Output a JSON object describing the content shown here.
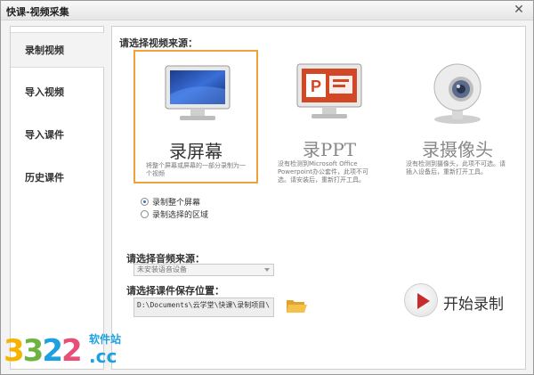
{
  "window": {
    "title": "快课-视频采集",
    "close_glyph": "✕"
  },
  "sidebar": {
    "items": [
      {
        "label": "录制视频",
        "active": true
      },
      {
        "label": "导入视频",
        "active": false
      },
      {
        "label": "导入课件",
        "active": false
      },
      {
        "label": "历史课件",
        "active": false
      }
    ]
  },
  "main": {
    "source_label": "请选择视频来源：",
    "cards": [
      {
        "title": "录屏幕",
        "desc": "将整个屏幕或屏幕的一部分录制为一个视频",
        "icon": "monitor-icon",
        "selected": true
      },
      {
        "title": "录PPT",
        "desc": "没有检测到Microsoft Office Powerpoint办公套件，此项不可选。请安装后，重新打开工具。",
        "icon": "powerpoint-icon",
        "selected": false
      },
      {
        "title": "录摄像头",
        "desc": "没有检测到摄像头，此项不可选。请插入设备后，重新打开工具。",
        "icon": "webcam-icon",
        "selected": false
      }
    ],
    "radios": [
      {
        "label": "录制整个屏幕",
        "checked": true
      },
      {
        "label": "录制选择的区域",
        "checked": false
      }
    ],
    "audio_label": "请选择音频来源：",
    "audio_value": "未安装语音设备",
    "save_label": "请选择课件保存位置：",
    "save_path": "D:\\Documents\\云学堂\\快课\\录制项目\\",
    "record_label": "开始录制"
  },
  "watermark": {
    "digits": [
      "3",
      "3",
      "2",
      "2"
    ],
    "text_top": "软件站",
    "text_cc": ".cc"
  },
  "colors": {
    "accent": "#f0a23a",
    "record": "#c72b2b",
    "panel_border": "#cfcfcf"
  }
}
